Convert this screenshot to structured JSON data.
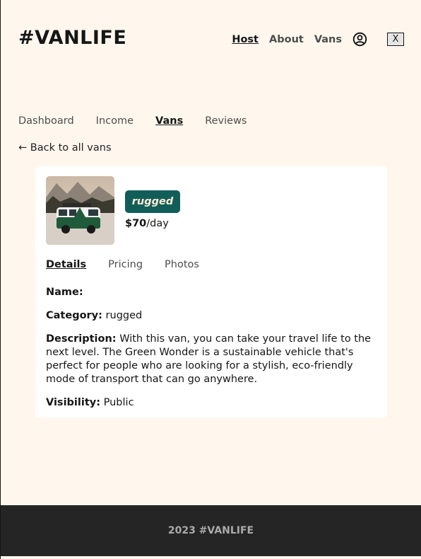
{
  "header": {
    "logo": "#VANLIFE",
    "nav": [
      {
        "label": "Host",
        "active": true
      },
      {
        "label": "About",
        "active": false
      },
      {
        "label": "Vans",
        "active": false
      }
    ],
    "avatar_icon": "user-circle-icon",
    "close_label": "X"
  },
  "host_nav": [
    {
      "label": "Dashboard",
      "active": false
    },
    {
      "label": "Income",
      "active": false
    },
    {
      "label": "Vans",
      "active": true
    },
    {
      "label": "Reviews",
      "active": false
    }
  ],
  "back_link": {
    "arrow": "←",
    "label": "Back to all vans"
  },
  "van": {
    "type_badge": "rugged",
    "badge_color": "#115E59",
    "price": "$70",
    "price_unit": "/day",
    "tabs": [
      {
        "label": "Details",
        "active": true
      },
      {
        "label": "Pricing",
        "active": false
      },
      {
        "label": "Photos",
        "active": false
      }
    ],
    "details": {
      "name_label": "Name:",
      "name_value": "",
      "category_label": "Category:",
      "category_value": "rugged",
      "description_label": "Description:",
      "description_value": "With this van, you can take your travel life to the next level. The Green Wonder is a sustainable vehicle that's perfect for people who are looking for a stylish, eco-friendly mode of transport that can go anywhere.",
      "visibility_label": "Visibility:",
      "visibility_value": "Public"
    }
  },
  "footer": {
    "text": "2023 #VANLIFE"
  }
}
